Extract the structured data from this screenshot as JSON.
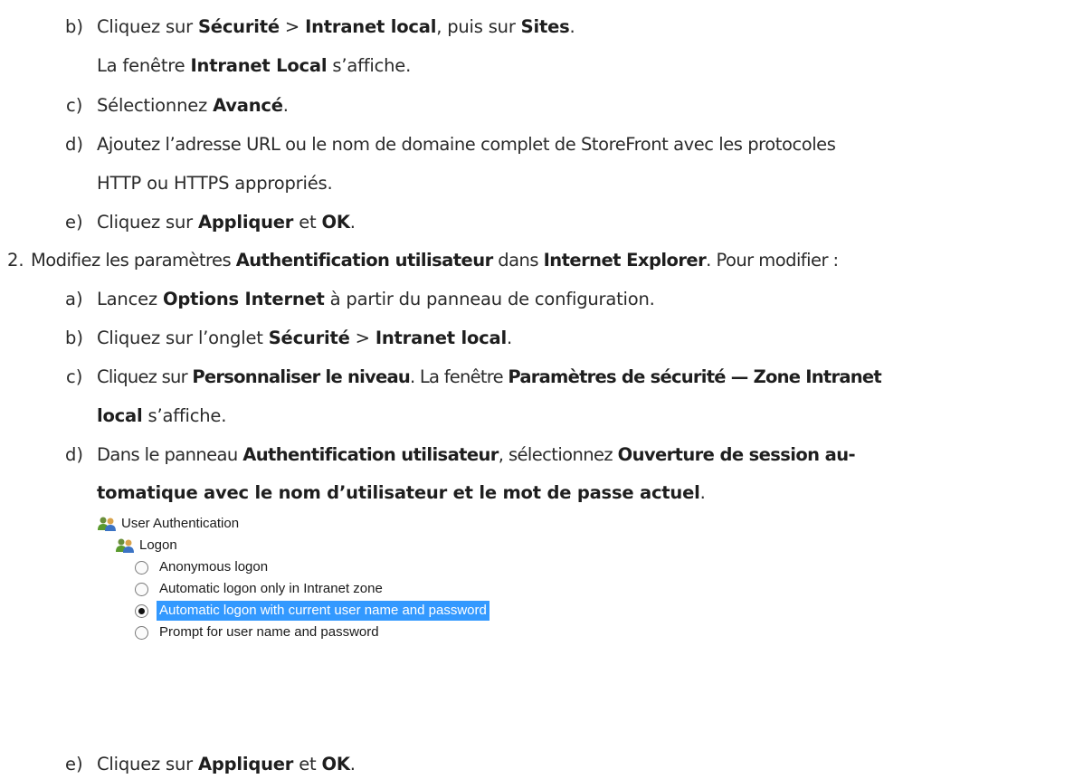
{
  "steps": {
    "b1": {
      "marker": "b)",
      "t1": "Cliquez sur ",
      "b1": "Sécurité",
      "t2": " > ",
      "b2": "Intranet local",
      "t3": ", puis sur ",
      "b3": "Sites",
      "t4": ".",
      "sub_t1": "La fenêtre ",
      "sub_b1": "Intranet Local",
      "sub_t2": " s’affiche."
    },
    "c1": {
      "marker": "c)",
      "t1": "Sélectionnez ",
      "b1": "Avancé",
      "t2": "."
    },
    "d1": {
      "marker": "d)",
      "line1": "Ajoutez l’adresse URL ou le nom de domaine complet de StoreFront avec les protocoles",
      "line2": "HTTP ou HTTPS appropriés."
    },
    "e1": {
      "marker": "e)",
      "t1": "Cliquez sur ",
      "b1": "Appliquer",
      "t2": " et ",
      "b2": "OK",
      "t3": "."
    },
    "step2": {
      "marker": "2.",
      "t1": "Modifiez les paramètres ",
      "b1": "Authentification utilisateur",
      "t2": " dans ",
      "b2": "Internet Explorer",
      "t3": ". Pour modifier :"
    },
    "a2": {
      "marker": "a)",
      "t1": "Lancez ",
      "b1": "Options Internet",
      "t2": " à partir du panneau de configuration."
    },
    "b2": {
      "marker": "b)",
      "t1": "Cliquez sur l’onglet ",
      "b1": "Sécurité",
      "t2": " > ",
      "b2": "Intranet local",
      "t3": "."
    },
    "c2": {
      "marker": "c)",
      "t1": "Cliquez sur ",
      "b1": "Personnaliser le niveau",
      "t2": ". La fenêtre ",
      "b2": "Paramètres de sécurité — Zone Intranet",
      "l2_b1": "local",
      "l2_t1": " s’affiche."
    },
    "d2": {
      "marker": "d)",
      "t1": "Dans le panneau ",
      "b1": "Authentification utilisateur",
      "t2": ", sélectionnez ",
      "b2": "Ouverture de session au-",
      "l2_b1": "tomatique avec le nom d’utilisateur et le mot de passe actuel",
      "l2_t1": "."
    },
    "e2": {
      "marker": "e)",
      "t1": "Cliquez sur ",
      "b1": "Appliquer",
      "t2": " et ",
      "b2": "OK",
      "t3": "."
    }
  },
  "screenshot": {
    "group_label": "User Authentication",
    "subgroup_label": "Logon",
    "options": [
      {
        "label": "Anonymous logon",
        "checked": false
      },
      {
        "label": "Automatic logon only in Intranet zone",
        "checked": false
      },
      {
        "label": "Automatic logon with current user name and password",
        "checked": true
      },
      {
        "label": "Prompt for user name and password",
        "checked": false
      }
    ],
    "colors": {
      "selection": "#3399ff"
    }
  }
}
